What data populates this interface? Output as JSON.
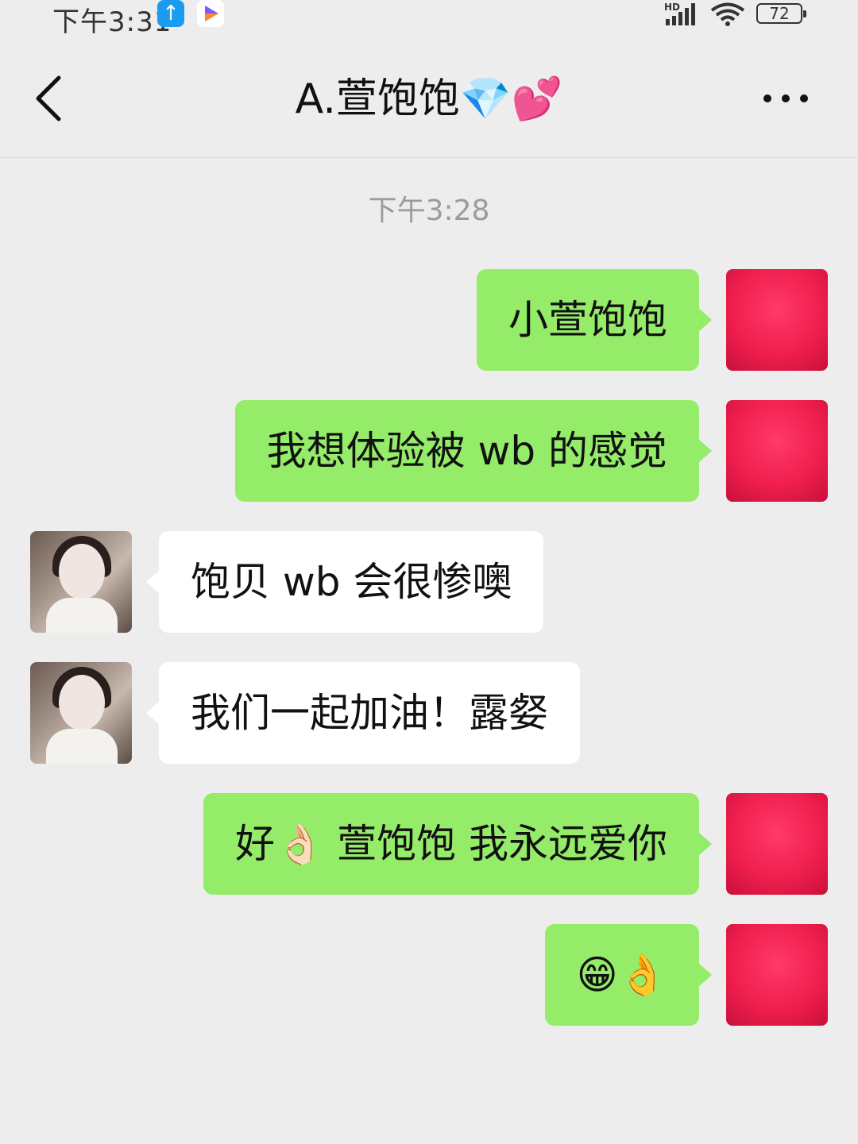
{
  "status_bar": {
    "time": "下午3:31",
    "battery": "72",
    "network_label": "HD"
  },
  "header": {
    "title": "A.萱饱饱💎💕"
  },
  "chat": {
    "timestamp": "下午3:28",
    "messages": [
      {
        "from": "me",
        "text": "小萱饱饱"
      },
      {
        "from": "me",
        "text": "我想体验被 wb 的感觉"
      },
      {
        "from": "them",
        "text": "饱贝 wb 会很惨噢"
      },
      {
        "from": "them",
        "text": "我们一起加油！露㛑"
      },
      {
        "from": "me",
        "text": "好👌🏻 萱饱饱 我永远爱你"
      },
      {
        "from": "me",
        "text": "😁👌"
      }
    ]
  },
  "colors": {
    "my_bubble": "#95ec69",
    "their_bubble": "#ffffff",
    "background": "#ededed",
    "my_avatar": "#f01f4e"
  }
}
